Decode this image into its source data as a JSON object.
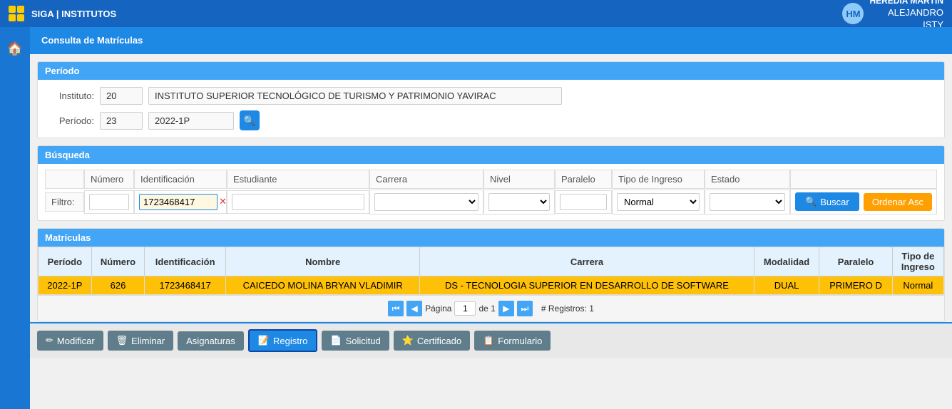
{
  "app": {
    "logo_alt": "SIGA logo",
    "title": "SIGA | INSTITUTOS"
  },
  "user": {
    "name": "HEREDIA MARTIN",
    "subtitle": "ALEJANDRO",
    "org": "ISTY",
    "initials": "HM"
  },
  "page": {
    "title": "Consulta de Matrículas"
  },
  "periodo_section": {
    "header": "Período",
    "instituto_label": "Instituto:",
    "instituto_code": "20",
    "instituto_name": "INSTITUTO SUPERIOR TECNOLÓGICO DE TURISMO Y PATRIMONIO YAVIRAC",
    "periodo_label": "Período:",
    "periodo_code": "23",
    "periodo_value": "2022-1P",
    "search_icon": "🔍"
  },
  "busqueda_section": {
    "header": "Búsqueda",
    "col_numero": "Número",
    "col_identificacion": "Identificación",
    "col_estudiante": "Estudiante",
    "col_carrera": "Carrera",
    "col_nivel": "Nivel",
    "col_paralelo": "Paralelo",
    "col_tipo_ingreso": "Tipo de Ingreso",
    "col_estado": "Estado",
    "filtro_label": "Filtro:",
    "filter_identificacion": "1723468417",
    "filter_tipo_ingreso": "Normal",
    "btn_sort": "Ordenar Asc",
    "btn_buscar": "Buscar"
  },
  "matriculas_section": {
    "header": "Matrículas",
    "col_periodo": "Período",
    "col_numero": "Número",
    "col_identificacion": "Identificación",
    "col_nombre": "Nombre",
    "col_carrera": "Carrera",
    "col_modalidad": "Modalidad",
    "col_paralelo": "Paralelo",
    "col_tipo_ingreso": "Tipo de Ingreso",
    "rows": [
      {
        "periodo": "2022-1P",
        "numero": "626",
        "identificacion": "1723468417",
        "nombre": "CAICEDO MOLINA BRYAN VLADIMIR",
        "carrera": "DS - TECNOLOGIA SUPERIOR EN DESARROLLO DE SOFTWARE",
        "modalidad": "DUAL",
        "paralelo": "PRIMERO D",
        "tipo_ingreso": "Normal",
        "selected": true
      }
    ],
    "pagination": {
      "page_label": "Página",
      "page_current": "1",
      "page_of": "de 1",
      "registros_label": "# Registros: 1"
    }
  },
  "actions": {
    "modificar": "Modificar",
    "eliminar": "Eliminar",
    "asignaturas": "Asignaturas",
    "registro": "Registro",
    "solicitud": "Solicitud",
    "certificado": "Certificado",
    "formulario": "Formulario"
  }
}
